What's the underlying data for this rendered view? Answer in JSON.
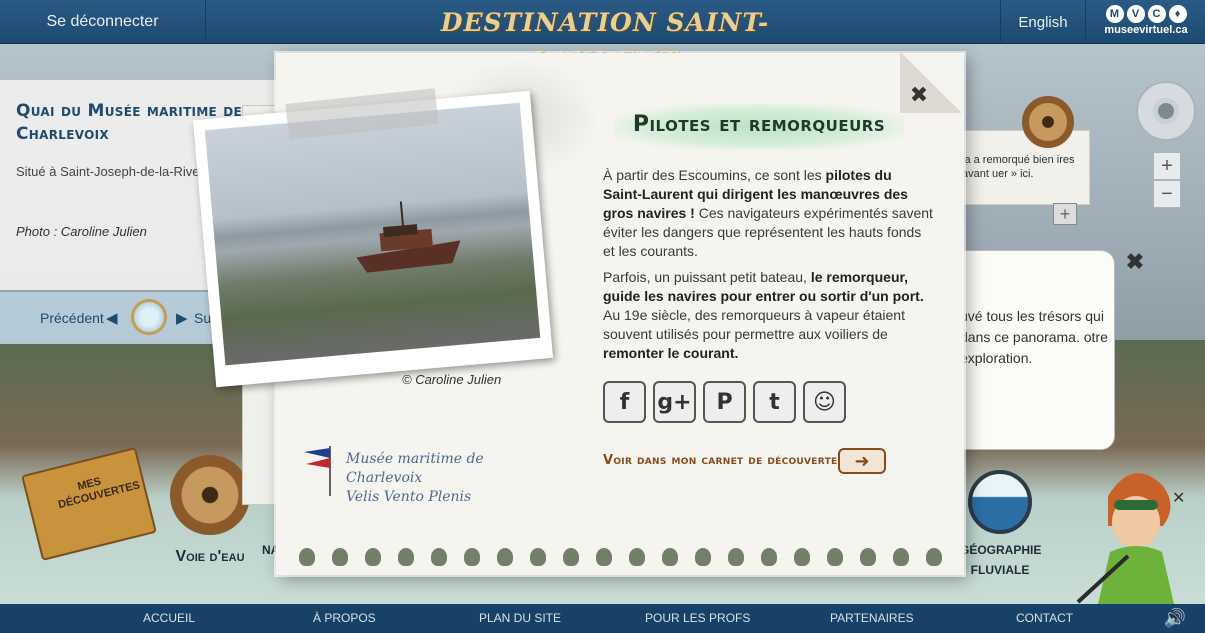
{
  "topbar": {
    "logout": "Se déconnecter",
    "brand": "DESTINATION SAINT-LAURENT",
    "language": "English",
    "mvc_letters": [
      "M",
      "V",
      "C"
    ],
    "mvc_site": "museevirtuel.ca"
  },
  "left_panel": {
    "title": "Quai du Musée maritime de Charlevoix",
    "description": "Situé à Saint-Joseph-de-la-Rive, s'élève au milieu du parc des na",
    "credit": "Photo : Caroline Julien",
    "prev": "Précédent",
    "next": "Sui"
  },
  "right_panel": {
    "card_text": "ia a remorqué bien ires avant uer » ici.",
    "plus": "+",
    "zoom_in": "+",
    "zoom_out": "−",
    "bubble_close": "✖",
    "bubble_text": "uvé tous les trésors qui dans ce panorama. otre exploration."
  },
  "bottom_items": {
    "carnet": "MES DÉCOUVERTES",
    "voie": "Voie d'eau",
    "nav": "NA OI",
    "geo": "GÉOGRAPHIE FLUVIALE",
    "char_close": "✕"
  },
  "footer": {
    "items": [
      "ACCUEIL",
      "À PROPOS",
      "PLAN DU SITE",
      "POUR LES PROFS",
      "PARTENAIRES",
      "CONTACT"
    ]
  },
  "modal": {
    "close": "✖",
    "title": "Pilotes et remorqueurs",
    "photo_credit": "© Caroline Julien",
    "museum_line1": "Musée maritime de Charlevoix",
    "museum_line2": "Velis Vento Plenis",
    "p1_a": "À partir des Escoumins, ce sont les ",
    "p1_b": "pilotes du Saint-Laurent qui dirigent les manœuvres des gros navires !",
    "p1_c": " Ces navigateurs expérimentés savent éviter les dangers que représentent les hauts fonds et les courants.",
    "p2_a": "Parfois, un puissant petit bateau, ",
    "p2_b": "le remorqueur, guide les navires pour entrer ou sortir d'un port.",
    "p2_c": " Au 19e siècle, des remorqueurs à vapeur étaient souvent utilisés pour permettre aux voiliers de ",
    "p2_d": "remonter le courant.",
    "social": [
      "f",
      "g+",
      "P",
      "t",
      "☺"
    ],
    "carnet_link": "Voir dans mon carnet de découvertes"
  }
}
